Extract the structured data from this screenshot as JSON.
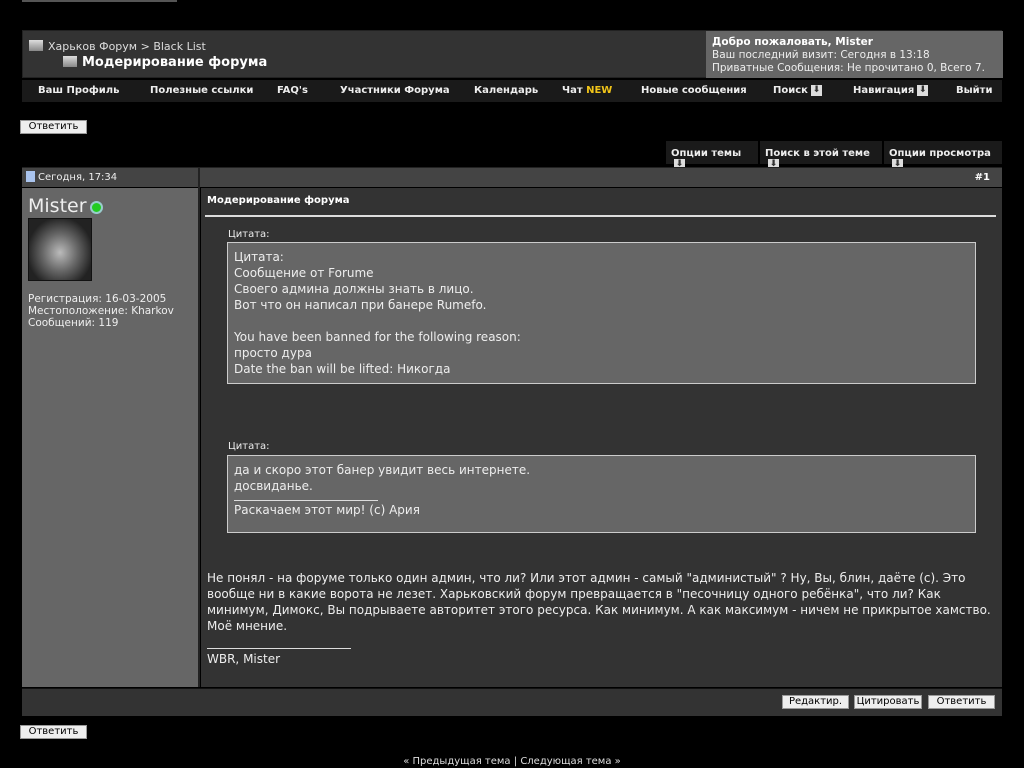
{
  "header": {
    "breadcrumb_home": "Харьков Форум",
    "breadcrumb_sep": ">",
    "breadcrumb_forum": "Black List",
    "thread_title": "Модерирование форума"
  },
  "welcome": {
    "greeting": "Добро пожаловать, Mister",
    "last_visit": "Ваш последний визит: Сегодня в 13:18",
    "pm": "Приватные Сообщения: Не прочитано 0, Всего 7."
  },
  "nav": {
    "items": [
      {
        "label": "Ваш Профиль"
      },
      {
        "label": "Полезные ссылки"
      },
      {
        "label": "FAQ's"
      },
      {
        "label": "Участники Форума"
      },
      {
        "label": "Календарь"
      },
      {
        "label": "Чат",
        "badge": "NEW"
      },
      {
        "label": "Новые сообщения"
      },
      {
        "label": "Поиск"
      },
      {
        "label": "Навигация"
      },
      {
        "label": "Выйти"
      }
    ],
    "badge_color": "#f0c419"
  },
  "reply_label": "Ответить",
  "thread_options": {
    "topic": "Опции темы",
    "search": "Поиск в этой теме",
    "view": "Опции просмотра"
  },
  "post": {
    "date": "Сегодня, 17:34",
    "number": "#1",
    "title": "Модерирование форума",
    "user": {
      "name": "Mister",
      "status": "online",
      "registration": "Регистрация: 16-03-2005",
      "location": "Местоположение: Kharkov",
      "posts": "Сообщений: 119"
    },
    "quotes": [
      {
        "label": "Цитата:",
        "lines": [
          "Цитата:",
          "Сообщение от Forume",
          "Своего админа должны знать в лицо.",
          "Вот что он написал при банере Rumefo.",
          "",
          "You have been banned for the following reason:",
          "просто дура",
          "Date the ban will be lifted: Никогда"
        ]
      },
      {
        "label": "Цитата:",
        "lines": [
          "да и скоро этот банер увидит весь интернете.",
          "досвиданье."
        ],
        "signature": "Раскачаем этот мир! (с) Ария"
      }
    ],
    "message": [
      "Не понял - на форуме только один админ, что ли? Или этот админ - самый \"администый\" ? Ну, Вы, блин, даёте (с). Это вообще ни в какие ворота не лезет. Харьковский форум превращается в \"песочницу одного ребёнка\", что ли? Как минимум, Димокс, Вы подрываете авторитет этого ресурса. Как минимум. А как максимум - ничем не прикрытое хамство.",
      "Моё мнение."
    ],
    "signature": "WBR, Mister",
    "actions": {
      "edit": "Редактир.",
      "quote": "Цитировать",
      "reply": "Ответить"
    }
  },
  "bottom_nav": {
    "prev": "« Предыдущая тема",
    "sep": "|",
    "next": "Следующая тема »"
  }
}
